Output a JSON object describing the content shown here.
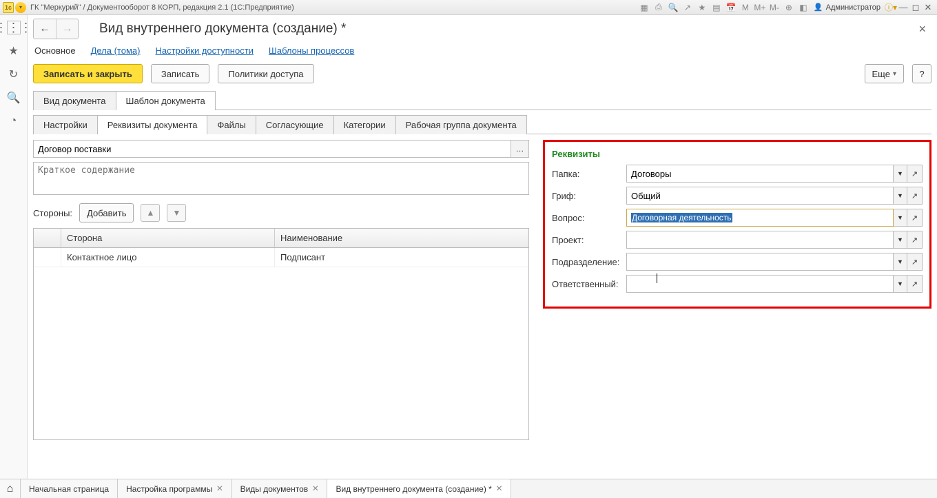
{
  "titlebar": {
    "title": "ГК \"Меркурий\" / Документооборот 8 КОРП, редакция 2.1  (1С:Предприятие)",
    "user": "Администратор"
  },
  "nav": {
    "page_title": "Вид внутреннего документа (создание) *"
  },
  "links": {
    "main": "Основное",
    "dela": "Дела (тома)",
    "access": "Настройки доступности",
    "templates": "Шаблоны процессов"
  },
  "buttons": {
    "save_close": "Записать и закрыть",
    "save": "Записать",
    "policies": "Политики доступа",
    "more": "Еще",
    "help": "?"
  },
  "tabs1": {
    "t1": "Вид документа",
    "t2": "Шаблон документа"
  },
  "tabs2": {
    "t1": "Настройки",
    "t2": "Реквизиты документа",
    "t3": "Файлы",
    "t4": "Согласующие",
    "t5": "Категории",
    "t6": "Рабочая группа документа"
  },
  "form": {
    "name_value": "Договор поставки",
    "brief_placeholder": "Краткое содержание",
    "sides_label": "Стороны:",
    "add_btn": "Добавить"
  },
  "grid": {
    "col1": "Сторона",
    "col2": "Наименование",
    "row1a": "Контактное лицо",
    "row1b": "Подписант"
  },
  "req": {
    "title": "Реквизиты",
    "folder_label": "Папка:",
    "folder_value": "Договоры",
    "grif_label": "Гриф:",
    "grif_value": "Общий",
    "topic_label": "Вопрос:",
    "topic_value": "Договорная деятельность",
    "project_label": "Проект:",
    "project_value": "",
    "dept_label": "Подразделение:",
    "dept_value": "",
    "resp_label": "Ответственный:",
    "resp_value": ""
  },
  "taskbar": {
    "t1": "Начальная страница",
    "t2": "Настройка программы",
    "t3": "Виды документов",
    "t4": "Вид внутреннего документа (создание) *"
  }
}
